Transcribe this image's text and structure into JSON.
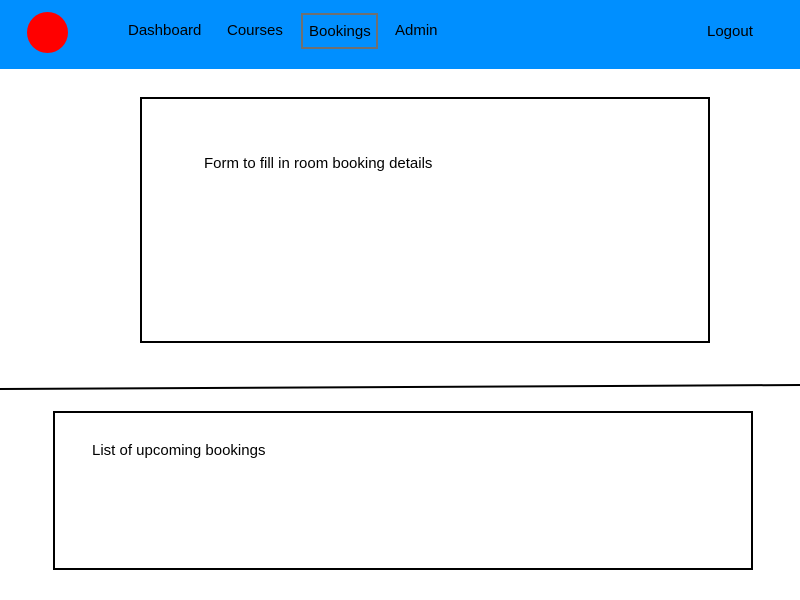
{
  "colors": {
    "navbar_background": "#008fff",
    "logo": "#ff0000",
    "active_tab_border": "#707070"
  },
  "navbar": {
    "logo_icon": "red-circle-logo",
    "links": [
      {
        "label": "Dashboard"
      },
      {
        "label": "Courses"
      },
      {
        "label": "Bookings",
        "active": true
      },
      {
        "label": "Admin"
      }
    ],
    "logout_label": "Logout"
  },
  "booking_form": {
    "placeholder_text": "Form to fill in room booking details"
  },
  "upcoming_bookings": {
    "placeholder_text": "List of upcoming bookings"
  }
}
